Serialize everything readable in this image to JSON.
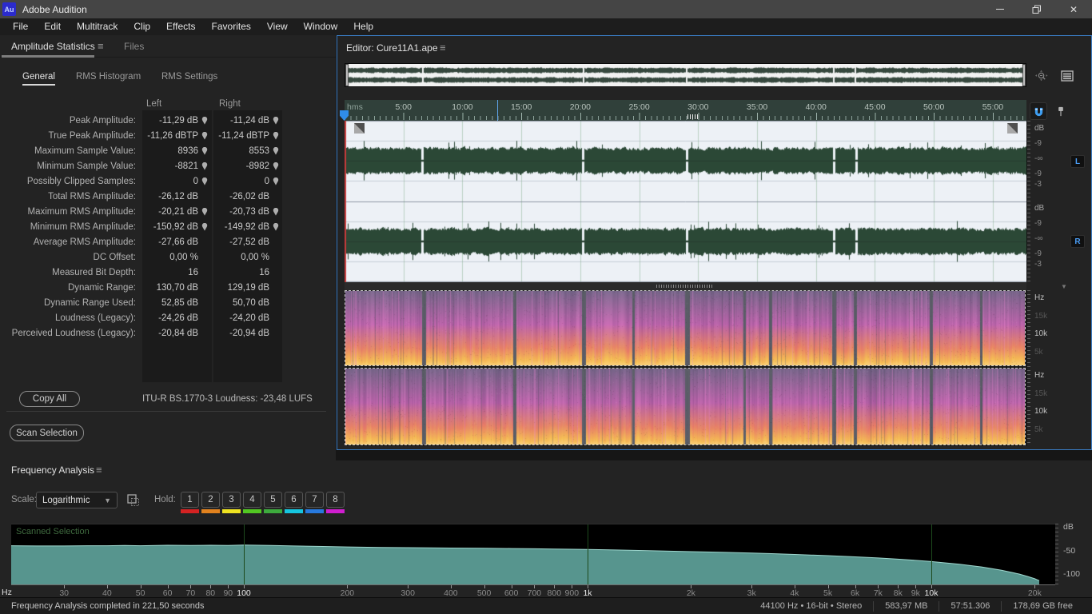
{
  "titlebar": {
    "title": "Adobe Audition",
    "logo_text": "Au"
  },
  "menubar": {
    "items": [
      "File",
      "Edit",
      "Multitrack",
      "Clip",
      "Effects",
      "Favorites",
      "View",
      "Window",
      "Help"
    ]
  },
  "stats_panel": {
    "tab": "Amplitude Statistics",
    "files_tab": "Files",
    "subtabs": [
      {
        "label": "General",
        "active": true
      },
      {
        "label": "RMS Histogram",
        "active": false
      },
      {
        "label": "RMS Settings",
        "active": false
      }
    ],
    "columns": {
      "left": "Left",
      "right": "Right"
    },
    "rows": [
      {
        "label": "Peak Amplitude:",
        "left": "-11,29 dB",
        "right": "-11,24 dB",
        "marker": true
      },
      {
        "label": "True Peak Amplitude:",
        "left": "-11,26 dBTP",
        "right": "-11,24 dBTP",
        "marker": true
      },
      {
        "label": "Maximum Sample Value:",
        "left": "8936",
        "right": "8553",
        "marker": true
      },
      {
        "label": "Minimum Sample Value:",
        "left": "-8821",
        "right": "-8982",
        "marker": true
      },
      {
        "label": "Possibly Clipped Samples:",
        "left": "0",
        "right": "0",
        "marker": true
      },
      {
        "label": "Total RMS Amplitude:",
        "left": "-26,12 dB",
        "right": "-26,02 dB",
        "marker": false
      },
      {
        "label": "Maximum RMS Amplitude:",
        "left": "-20,21 dB",
        "right": "-20,73 dB",
        "marker": true
      },
      {
        "label": "Minimum RMS Amplitude:",
        "left": "-150,92 dB",
        "right": "-149,92 dB",
        "marker": true
      },
      {
        "label": "Average RMS Amplitude:",
        "left": "-27,66 dB",
        "right": "-27,52 dB",
        "marker": false
      },
      {
        "label": "DC Offset:",
        "left": "0,00 %",
        "right": "0,00 %",
        "marker": false
      },
      {
        "label": "Measured Bit Depth:",
        "left": "16",
        "right": "16",
        "marker": false
      },
      {
        "label": "Dynamic Range:",
        "left": "130,70 dB",
        "right": "129,19 dB",
        "marker": false
      },
      {
        "label": "Dynamic Range Used:",
        "left": "52,85 dB",
        "right": "50,70 dB",
        "marker": false
      },
      {
        "label": "Loudness (Legacy):",
        "left": "-24,26 dB",
        "right": "-24,20 dB",
        "marker": false
      },
      {
        "label": "Perceived Loudness (Legacy):",
        "left": "-20,84 dB",
        "right": "-20,94 dB",
        "marker": false
      }
    ],
    "copy_all_label": "Copy All",
    "loudness_summary": "ITU-R BS.1770-3 Loudness:  -23,48 LUFS",
    "scan_selection_label": "Scan Selection"
  },
  "editor": {
    "tab_label": "Editor: Cure11A1.ape",
    "ruler_unit": "hms",
    "ruler_labels": [
      "5:00",
      "10:00",
      "15:00",
      "20:00",
      "25:00",
      "30:00",
      "35:00",
      "40:00",
      "45:00",
      "50:00",
      "55:00"
    ],
    "amp_scale_labels": [
      "dB",
      "-9",
      "-∞",
      "-9",
      "-3"
    ],
    "freq_scale_labels": [
      {
        "text": "Hz",
        "bright": true
      },
      {
        "text": "15k",
        "bright": false
      },
      {
        "text": "10k",
        "bright": true
      },
      {
        "text": "5k",
        "bright": false
      }
    ],
    "channel_badges": [
      "L",
      "R"
    ],
    "song_gaps": [
      {
        "at": 0.112,
        "w": 5
      },
      {
        "at": 0.247,
        "w": 4
      },
      {
        "at": 0.348,
        "w": 5
      },
      {
        "at": 0.422,
        "w": 3
      },
      {
        "at": 0.5,
        "w": 6
      },
      {
        "at": 0.585,
        "w": 3
      },
      {
        "at": 0.623,
        "w": 4
      },
      {
        "at": 0.716,
        "w": 5
      },
      {
        "at": 0.748,
        "w": 4
      },
      {
        "at": 0.86,
        "w": 4
      },
      {
        "at": 0.934,
        "w": 3
      }
    ],
    "wave_gaps": [
      0.112,
      0.348,
      0.5,
      0.716,
      0.748
    ],
    "colors": {
      "waveform": "#2b4836",
      "wave_bg": "#edf1f6",
      "ruler_bg": "#30403a",
      "playhead": "#c23a3a",
      "focus_border": "#3a7cc4",
      "magnet": "#3d9df0"
    }
  },
  "frequency_analysis": {
    "title": "Frequency Analysis",
    "scale_label": "Scale:",
    "scale_value": "Logarithmic",
    "hold_label": "Hold:",
    "hold_buttons": [
      {
        "label": "1",
        "color": "#d42222"
      },
      {
        "label": "2",
        "color": "#e2821e"
      },
      {
        "label": "3",
        "color": "#efe321"
      },
      {
        "label": "4",
        "color": "#52c822"
      },
      {
        "label": "5",
        "color": "#3dab3d"
      },
      {
        "label": "6",
        "color": "#16c6e0"
      },
      {
        "label": "7",
        "color": "#2779de"
      },
      {
        "label": "8",
        "color": "#cf1ecf"
      }
    ],
    "overlay_label": "Scanned Selection"
  },
  "chart_data": {
    "type": "area",
    "title": "Frequency Analysis — Scanned Selection",
    "xlabel": "Hz",
    "ylabel": "dB",
    "x_log": true,
    "x_range": [
      20,
      21000
    ],
    "y_range": [
      -120,
      0
    ],
    "x_unit": "Hz",
    "x_gridlines": [
      100,
      1000,
      10000
    ],
    "x_ticks": [
      {
        "f": 30,
        "label": "30"
      },
      {
        "f": 40,
        "label": "40"
      },
      {
        "f": 50,
        "label": "50"
      },
      {
        "f": 60,
        "label": "60"
      },
      {
        "f": 70,
        "label": "70"
      },
      {
        "f": 80,
        "label": "80"
      },
      {
        "f": 90,
        "label": "90"
      },
      {
        "f": 100,
        "label": "100",
        "bright": true
      },
      {
        "f": 200,
        "label": "200"
      },
      {
        "f": 300,
        "label": "300"
      },
      {
        "f": 400,
        "label": "400"
      },
      {
        "f": 500,
        "label": "500"
      },
      {
        "f": 600,
        "label": "600"
      },
      {
        "f": 700,
        "label": "700"
      },
      {
        "f": 800,
        "label": "800"
      },
      {
        "f": 900,
        "label": "900"
      },
      {
        "f": 1000,
        "label": "1k",
        "bright": true
      },
      {
        "f": 2000,
        "label": "2k"
      },
      {
        "f": 3000,
        "label": "3k"
      },
      {
        "f": 4000,
        "label": "4k"
      },
      {
        "f": 5000,
        "label": "5k"
      },
      {
        "f": 6000,
        "label": "6k"
      },
      {
        "f": 7000,
        "label": "7k"
      },
      {
        "f": 8000,
        "label": "8k"
      },
      {
        "f": 9000,
        "label": "9k"
      },
      {
        "f": 10000,
        "label": "10k",
        "bright": true
      },
      {
        "f": 20000,
        "label": "20k"
      }
    ],
    "y_ticks": [
      {
        "label": "dB",
        "db": 0
      },
      {
        "label": "-50",
        "db": -50
      },
      {
        "label": "-100",
        "db": -100
      }
    ],
    "points": [
      [
        20,
        -40
      ],
      [
        25,
        -40.5
      ],
      [
        30,
        -40.5
      ],
      [
        35,
        -40
      ],
      [
        40,
        -40
      ],
      [
        45,
        -39.5
      ],
      [
        50,
        -40
      ],
      [
        60,
        -39
      ],
      [
        70,
        -39.5
      ],
      [
        80,
        -39
      ],
      [
        90,
        -39.5
      ],
      [
        100,
        -38.5
      ],
      [
        120,
        -39.5
      ],
      [
        140,
        -40.5
      ],
      [
        170,
        -41.5
      ],
      [
        200,
        -42.5
      ],
      [
        250,
        -43.5
      ],
      [
        300,
        -44
      ],
      [
        350,
        -44.5
      ],
      [
        400,
        -45
      ],
      [
        500,
        -45.5
      ],
      [
        600,
        -46
      ],
      [
        700,
        -46.5
      ],
      [
        800,
        -47
      ],
      [
        900,
        -47.5
      ],
      [
        1000,
        -48
      ],
      [
        1200,
        -49
      ],
      [
        1500,
        -50.5
      ],
      [
        2000,
        -52.5
      ],
      [
        2500,
        -54
      ],
      [
        3000,
        -55.5
      ],
      [
        3500,
        -57
      ],
      [
        4000,
        -58.5
      ],
      [
        5000,
        -61
      ],
      [
        6000,
        -63.5
      ],
      [
        7000,
        -66
      ],
      [
        8000,
        -68.5
      ],
      [
        9000,
        -71
      ],
      [
        10000,
        -73.5
      ],
      [
        12000,
        -79
      ],
      [
        14000,
        -85
      ],
      [
        16000,
        -92
      ],
      [
        18000,
        -100
      ],
      [
        19000,
        -105
      ],
      [
        20000,
        -110
      ],
      [
        20600,
        -114
      ]
    ],
    "fill_color": "#63aaa2",
    "stroke_color": "#9fd8cf"
  },
  "statusbar": {
    "left": "Frequency Analysis completed in 221,50 seconds",
    "items": [
      "44100 Hz • 16-bit • Stereo",
      "583,97 MB",
      "57:51.306",
      "178,69 GB free"
    ]
  }
}
